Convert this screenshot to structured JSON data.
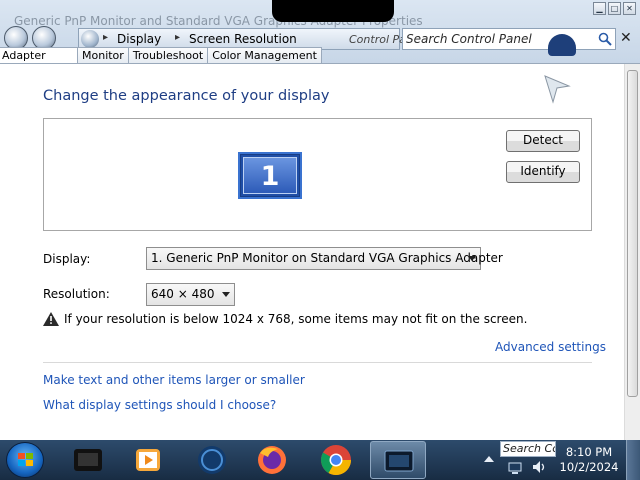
{
  "window": {
    "title_ghost": "Generic PnP Monitor and Standard VGA Graphics Adapter Properties",
    "controls": {
      "minimize": "▁",
      "maximize": "□",
      "close": "✕"
    }
  },
  "navbar": {
    "breadcrumbs": [
      "Display",
      "Screen Resolution"
    ],
    "address_ghost": "Control Panel",
    "search_placeholder": "Search Control Panel"
  },
  "tabs": [
    "Adapter",
    "Monitor",
    "Troubleshoot",
    "Color Management"
  ],
  "main": {
    "heading": "Change the appearance of your display",
    "monitor_number": "1",
    "detect_label": "Detect",
    "identify_label": "Identify",
    "display_label": "Display:",
    "display_value": "1. Generic PnP Monitor on Standard VGA Graphics Adapter",
    "resolution_label": "Resolution:",
    "resolution_value": "640 × 480",
    "warning_text": "If your resolution is below 1024 x 768, some items may not fit on the screen.",
    "advanced_link": "Advanced settings",
    "link_text_size": "Make text and other items larger or smaller",
    "link_help": "What display settings should I choose?"
  },
  "taskbar": {
    "search_placeholder": "Search Co",
    "time": "8:10 PM",
    "date": "10/2/2024",
    "apps": [
      "media-center-icon",
      "media-player-icon",
      "globe-icon",
      "firefox-icon",
      "chrome-icon",
      "display-properties-icon"
    ]
  }
}
